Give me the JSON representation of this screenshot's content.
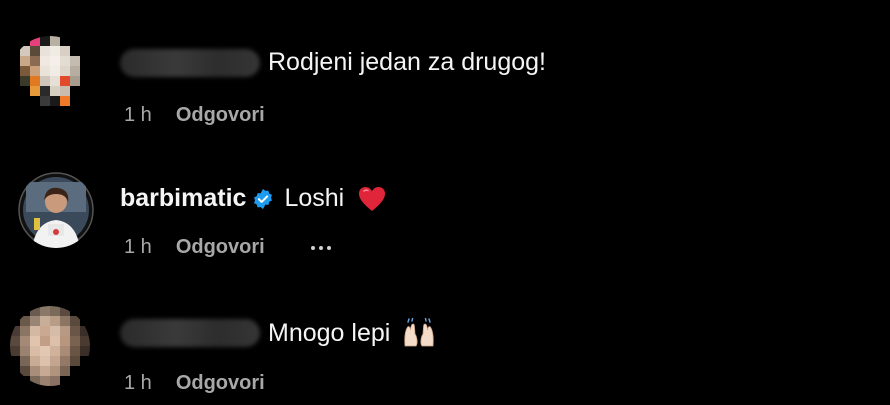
{
  "comments": [
    {
      "author_visible": false,
      "text": "Rodjeni jedan za drugog!",
      "time": "1 h",
      "reply_label": "Odgovori"
    },
    {
      "author_visible": true,
      "author": "barbimatic",
      "verified_icon": "verified-badge-icon",
      "text": "Loshi",
      "emoji": "heart-icon",
      "time": "1 h",
      "reply_label": "Odgovori",
      "more_icon": "more-options-icon"
    },
    {
      "author_visible": false,
      "text": "Mnogo lepi",
      "emoji": "raising-hands-icon",
      "time": "1 h",
      "reply_label": "Odgovori"
    }
  ],
  "colors": {
    "background": "#000000",
    "text": "#f5f5f5",
    "meta": "#a8a8a8",
    "verified": "#1d9bf0",
    "heart": "#e0243a"
  }
}
